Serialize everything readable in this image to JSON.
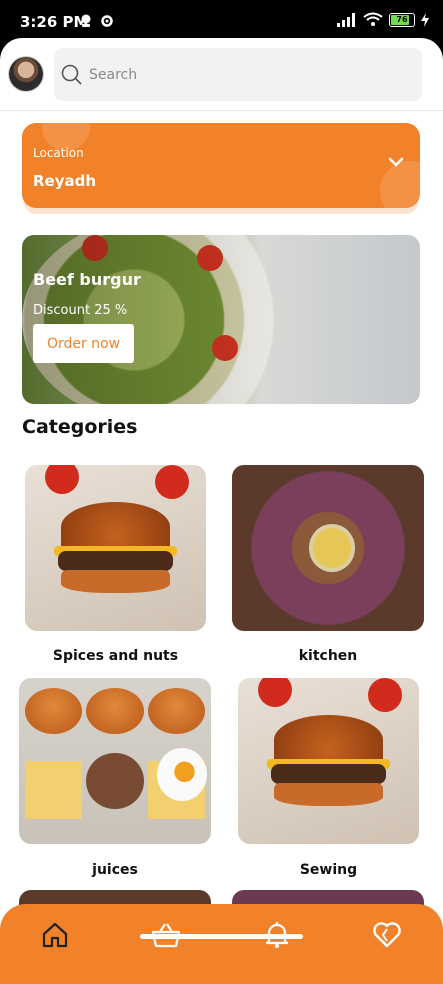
{
  "status_bar": {
    "time": "3:26 PM",
    "battery": "76"
  },
  "search": {
    "placeholder": "Search"
  },
  "location": {
    "label": "Location",
    "value": "Reyadh"
  },
  "promo": {
    "title": "Beef burgur",
    "discount": "Discount 25 %",
    "button": "Order now"
  },
  "categories": {
    "title": "Categories",
    "items": [
      {
        "label": "Spices and nuts"
      },
      {
        "label": "kitchen"
      },
      {
        "label": "juices"
      },
      {
        "label": "Sewing"
      }
    ]
  },
  "nav": {
    "items": [
      "home-icon",
      "basket-icon",
      "bell-icon",
      "heart-icon"
    ]
  },
  "colors": {
    "accent": "#f2822a"
  }
}
